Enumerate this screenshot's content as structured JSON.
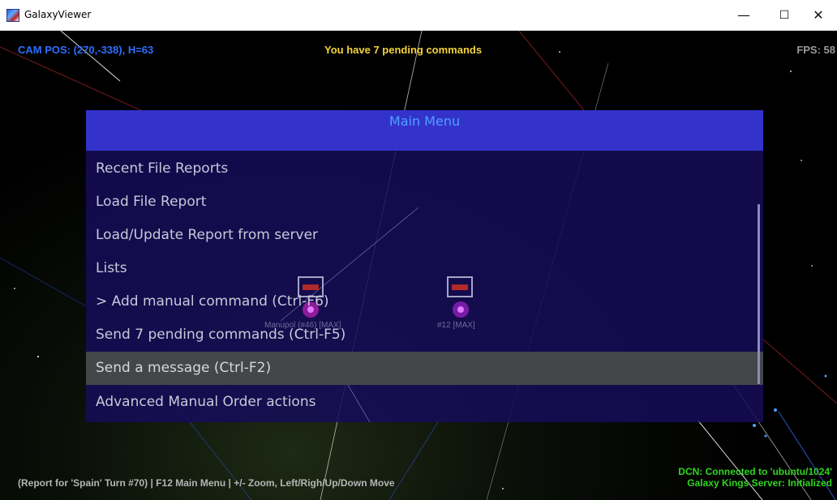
{
  "window": {
    "title": "GalaxyViewer",
    "icon": "galaxy-app-icon",
    "controls": {
      "minimize": "—",
      "maximize": "☐",
      "close": "✕"
    }
  },
  "hud": {
    "cam_pos": "CAM POS: (270,-338), H=63",
    "pending": "You have 7 pending commands",
    "fps": "FPS: 58",
    "footer": "(Report for 'Spain' Turn #70) | F12 Main Menu | +/- Zoom, Left/Righ/Up/Down Move",
    "dcn": "DCN: Connected to 'ubuntu/1024'",
    "server": "Galaxy Kings Server: Initialized"
  },
  "planets": [
    {
      "label": "Manupol (#46) [MAX]"
    },
    {
      "label": "#12 [MAX]"
    }
  ],
  "menu": {
    "title": "Main Menu",
    "items": [
      {
        "label": "Recent File Reports"
      },
      {
        "label": "Load File Report"
      },
      {
        "label": "Load/Update Report from server"
      },
      {
        "label": "Lists"
      },
      {
        "label": "> Add manual command (Ctrl-F6)"
      },
      {
        "label": "Send 7 pending commands (Ctrl-F5)"
      },
      {
        "label": "Send a message (Ctrl-F2)",
        "selected": true
      },
      {
        "label": "Advanced Manual Order actions"
      }
    ]
  },
  "colors": {
    "cam_pos": "#2f6fff",
    "pending": "#f4d33a",
    "status_green": "#2fd61f",
    "menu_header": "#3333cc",
    "menu_title": "#4fa0ff",
    "menu_body": "#160c58",
    "menu_selected": "#44464a"
  }
}
